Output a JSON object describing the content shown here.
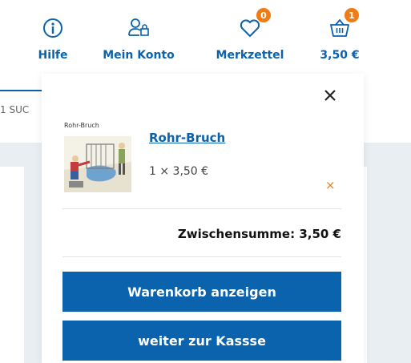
{
  "header": {
    "help": {
      "label": "Hilfe",
      "icon": "info-circle-icon"
    },
    "account": {
      "label": "Mein Konto",
      "icon": "user-lock-icon"
    },
    "wishlist": {
      "label": "Merkzettel",
      "icon": "heart-icon",
      "badge": "0"
    },
    "cart": {
      "label": "3,50 €",
      "icon": "basket-icon",
      "badge": "1"
    }
  },
  "background": {
    "search_fragment": "1 SUC"
  },
  "cart_popup": {
    "item": {
      "thumbnail_caption": "Rohr-Bruch",
      "title": "Rohr-Bruch",
      "quantity_price": "1 × 3,50 €"
    },
    "subtotal": "Zwischensumme: 3,50 €",
    "view_cart_label": "Warenkorb anzeigen",
    "checkout_label": "weiter zur Kassse"
  },
  "colors": {
    "brand_blue": "#0b62ad",
    "accent_orange": "#f07c16"
  }
}
